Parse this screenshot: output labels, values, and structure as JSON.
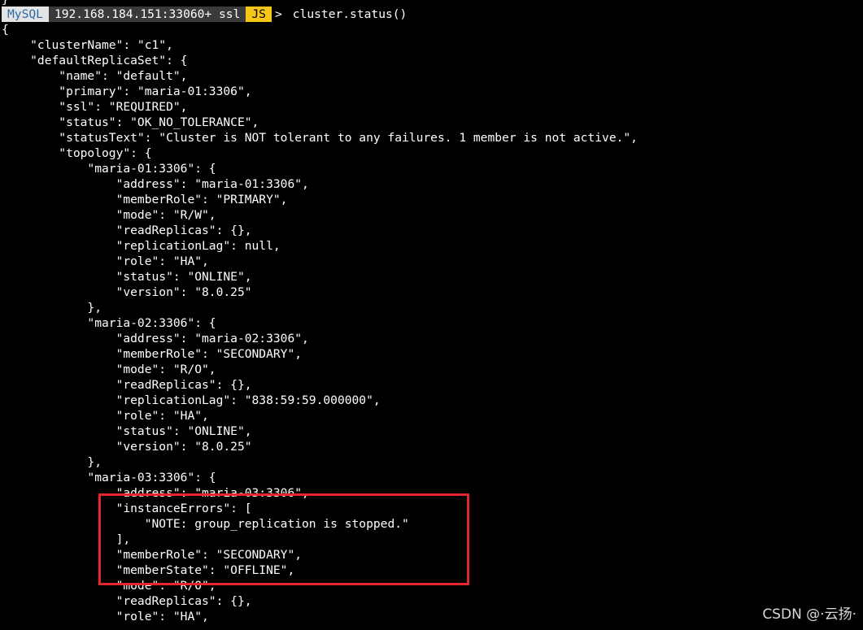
{
  "prompt": {
    "mysql_label": "MySQL",
    "host": "192.168.184.151:33060+ ssl",
    "mode": "JS",
    "caret": ">",
    "command": "cluster.status()"
  },
  "output_partial_top": "}",
  "output_lines": [
    "{",
    "    \"clusterName\": \"c1\",",
    "    \"defaultReplicaSet\": {",
    "        \"name\": \"default\",",
    "        \"primary\": \"maria-01:3306\",",
    "        \"ssl\": \"REQUIRED\",",
    "        \"status\": \"OK_NO_TOLERANCE\",",
    "        \"statusText\": \"Cluster is NOT tolerant to any failures. 1 member is not active.\",",
    "        \"topology\": {",
    "            \"maria-01:3306\": {",
    "                \"address\": \"maria-01:3306\",",
    "                \"memberRole\": \"PRIMARY\",",
    "                \"mode\": \"R/W\",",
    "                \"readReplicas\": {},",
    "                \"replicationLag\": null,",
    "                \"role\": \"HA\",",
    "                \"status\": \"ONLINE\",",
    "                \"version\": \"8.0.25\"",
    "            },",
    "            \"maria-02:3306\": {",
    "                \"address\": \"maria-02:3306\",",
    "                \"memberRole\": \"SECONDARY\",",
    "                \"mode\": \"R/O\",",
    "                \"readReplicas\": {},",
    "                \"replicationLag\": \"838:59:59.000000\",",
    "                \"role\": \"HA\",",
    "                \"status\": \"ONLINE\",",
    "                \"version\": \"8.0.25\"",
    "            },",
    "            \"maria-03:3306\": {",
    "                \"address\": \"maria-03:3306\",",
    "                \"instanceErrors\": [",
    "                    \"NOTE: group_replication is stopped.\"",
    "                ],",
    "                \"memberRole\": \"SECONDARY\",",
    "                \"memberState\": \"OFFLINE\",",
    "                \"mode\": \"R/O\",",
    "                \"readReplicas\": {},",
    "                \"role\": \"HA\","
  ],
  "watermark": "CSDN @·云扬·",
  "colors": {
    "background": "#000000",
    "text": "#ffffff",
    "mysql_segment_bg": "#e4e4e4",
    "mysql_segment_text": "#2b6aa8",
    "host_segment_bg": "#3a3a3a",
    "js_segment_bg": "#f5c518",
    "highlight_border": "#e5262f"
  }
}
